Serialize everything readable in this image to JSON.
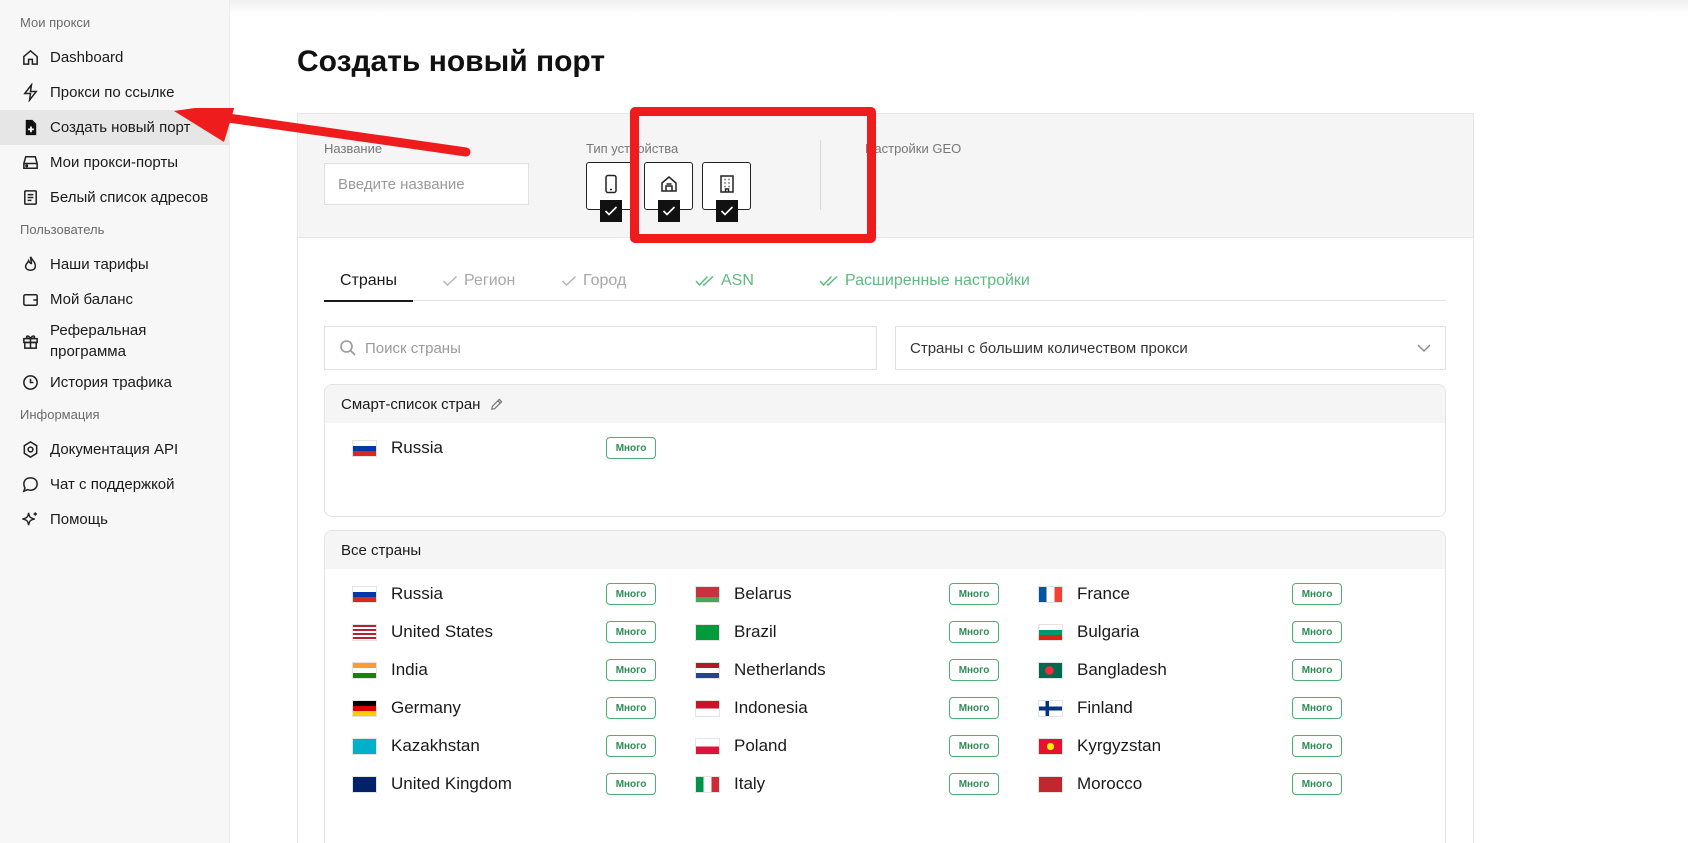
{
  "sidebar": {
    "sections": [
      {
        "title": "Мои прокси",
        "items": [
          {
            "label": "Dashboard",
            "icon": "home-icon"
          },
          {
            "label": "Прокси по ссылке",
            "icon": "lightning-icon"
          },
          {
            "label": "Создать новый порт",
            "icon": "file-plus-icon",
            "active": true
          },
          {
            "label": "Мои прокси-порты",
            "icon": "server-icon"
          },
          {
            "label": "Белый список адресов",
            "icon": "list-doc-icon"
          }
        ]
      },
      {
        "title": "Пользователь",
        "items": [
          {
            "label": "Наши тарифы",
            "icon": "flame-icon"
          },
          {
            "label": "Мой баланс",
            "icon": "wallet-icon"
          },
          {
            "label": "Реферальная программа",
            "icon": "gift-icon"
          },
          {
            "label": "История трафика",
            "icon": "clock-icon"
          }
        ]
      },
      {
        "title": "Информация",
        "items": [
          {
            "label": "Документация API",
            "icon": "settings-icon"
          },
          {
            "label": "Чат с поддержкой",
            "icon": "chat-icon"
          },
          {
            "label": "Помощь",
            "icon": "sparkle-icon"
          }
        ]
      }
    ]
  },
  "main": {
    "title": "Создать новый порт",
    "form": {
      "name_label": "Название",
      "name_placeholder": "Введите название",
      "device_label": "Тип устройства",
      "devices": [
        {
          "name": "mobile",
          "icon": "phone-icon",
          "checked": true
        },
        {
          "name": "residential",
          "icon": "house-icon",
          "checked": true
        },
        {
          "name": "datacenter",
          "icon": "building-icon",
          "checked": true
        }
      ],
      "geo_label": "Настройки GEO"
    },
    "tabs": [
      {
        "label": "Страны",
        "state": "active"
      },
      {
        "label": "Регион",
        "state": "disabled"
      },
      {
        "label": "Город",
        "state": "disabled"
      },
      {
        "label": "ASN",
        "state": "done"
      },
      {
        "label": "Расширенные настройки",
        "state": "done"
      }
    ],
    "search": {
      "placeholder": "Поиск страны"
    },
    "sort_select": {
      "value": "Страны с большим количеством прокси"
    },
    "smart_list": {
      "title": "Смарт-список стран",
      "countries": [
        {
          "name": "Russia",
          "badge": "Много"
        }
      ]
    },
    "all_countries": {
      "title": "Все страны",
      "columns": [
        [
          {
            "name": "Russia",
            "badge": "Много"
          },
          {
            "name": "United States",
            "badge": "Много"
          },
          {
            "name": "India",
            "badge": "Много"
          },
          {
            "name": "Germany",
            "badge": "Много"
          },
          {
            "name": "Kazakhstan",
            "badge": "Много"
          },
          {
            "name": "United Kingdom",
            "badge": "Много"
          }
        ],
        [
          {
            "name": "Belarus",
            "badge": "Много"
          },
          {
            "name": "Brazil",
            "badge": "Много"
          },
          {
            "name": "Netherlands",
            "badge": "Много"
          },
          {
            "name": "Indonesia",
            "badge": "Много"
          },
          {
            "name": "Poland",
            "badge": "Много"
          },
          {
            "name": "Italy",
            "badge": "Много"
          }
        ],
        [
          {
            "name": "France",
            "badge": "Много"
          },
          {
            "name": "Bulgaria",
            "badge": "Много"
          },
          {
            "name": "Bangladesh",
            "badge": "Много"
          },
          {
            "name": "Finland",
            "badge": "Много"
          },
          {
            "name": "Kyrgyzstan",
            "badge": "Много"
          },
          {
            "name": "Morocco",
            "badge": "Много"
          }
        ]
      ]
    }
  },
  "colors": {
    "annotation_red": "#ee1c1c",
    "badge_green": "#4caf73",
    "tab_done_green": "#5cbb80"
  }
}
